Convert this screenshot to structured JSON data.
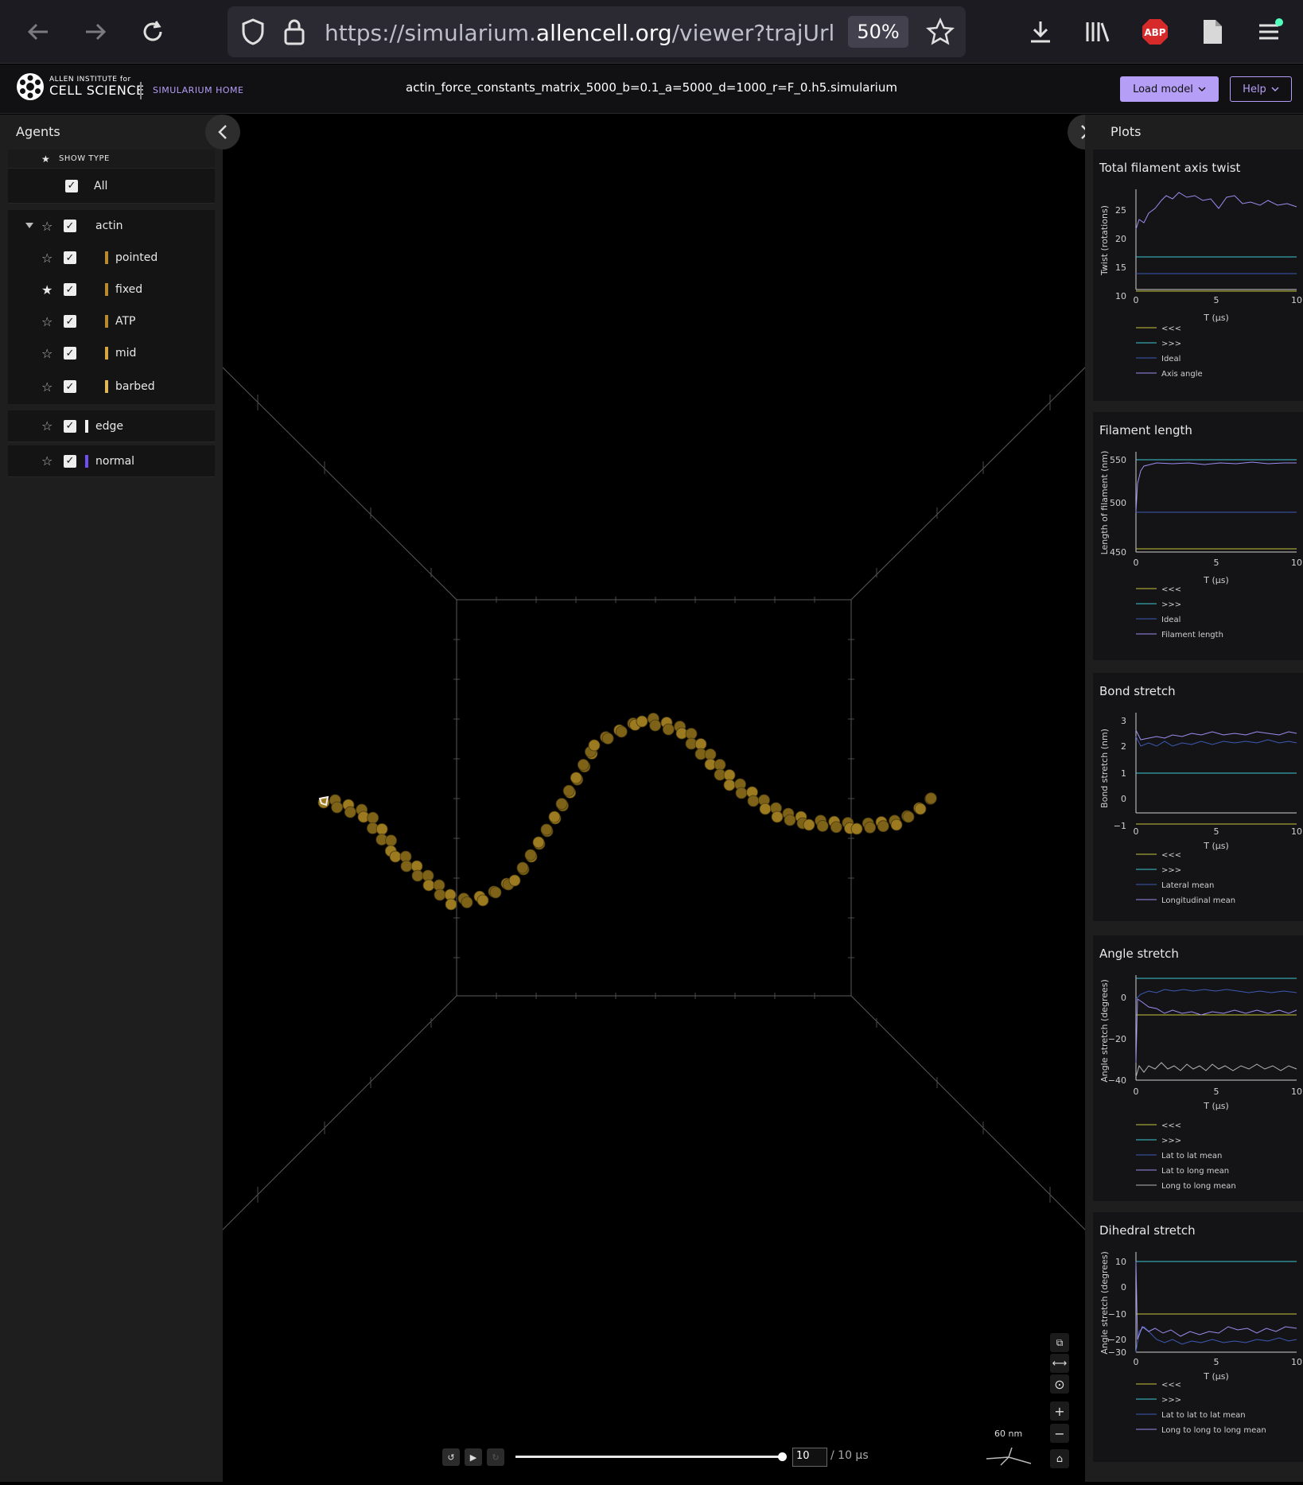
{
  "browser": {
    "url_prefix": "https://simularium.",
    "url_domain": "allencell.org",
    "url_suffix": "/viewer?trajUrl=http",
    "zoom": "50%",
    "abp_label": "ABP"
  },
  "header": {
    "logo_small": "ALLEN INSTITUTE for",
    "logo_big": "CELL SCIENCE",
    "home_link": "SIMULARIUM HOME",
    "file_title": "actin_force_constants_matrix_5000_b=0.1_a=5000_d=1000_r=F_0.h5.simularium",
    "load_model": "Load model",
    "help": "Help"
  },
  "agents_panel": {
    "title": "Agents",
    "show_type": "SHOW TYPE",
    "all_label": "All",
    "groups": [
      {
        "name": "actin",
        "color": "",
        "children": [
          {
            "name": "pointed",
            "color": "#b88a2e",
            "starred": false
          },
          {
            "name": "fixed",
            "color": "#b88a2e",
            "starred": true
          },
          {
            "name": "ATP",
            "color": "#b88a2e",
            "starred": false
          },
          {
            "name": "mid",
            "color": "#d7a640",
            "starred": false
          },
          {
            "name": "barbed",
            "color": "#e0b85a",
            "starred": false
          }
        ]
      },
      {
        "name": "edge",
        "color": "#f0f0f0",
        "children": []
      },
      {
        "name": "normal",
        "color": "#6f4ff0",
        "children": []
      }
    ]
  },
  "plots_panel": {
    "title": "Plots",
    "plots": [
      {
        "title": "Total filament axis twist",
        "ylabel": "Twist (rotations)",
        "xlabel": "T (µs)",
        "yticks": [
          "25",
          "20",
          "15",
          "10"
        ],
        "xticks": [
          "0",
          "5",
          "10"
        ],
        "legend": [
          "<<<",
          ">>>",
          "Ideal",
          "Axis angle"
        ]
      },
      {
        "title": "Filament length",
        "ylabel": "Length of filament (nm)",
        "xlabel": "T (µs)",
        "yticks": [
          "550",
          "500",
          "450"
        ],
        "xticks": [
          "0",
          "5",
          "10"
        ],
        "legend": [
          "<<<",
          ">>>",
          "Ideal",
          "Filament length"
        ]
      },
      {
        "title": "Bond stretch",
        "ylabel": "Bond stretch (nm)",
        "xlabel": "T (µs)",
        "yticks": [
          "3",
          "2",
          "1",
          "0",
          "−1"
        ],
        "xticks": [
          "0",
          "5",
          "10"
        ],
        "legend": [
          "<<<",
          ">>>",
          "Lateral mean",
          "Longitudinal mean"
        ]
      },
      {
        "title": "Angle stretch",
        "ylabel": "Angle stretch (degrees)",
        "xlabel": "T (µs)",
        "yticks": [
          "0",
          "−20",
          "−40"
        ],
        "xticks": [
          "0",
          "5",
          "10"
        ],
        "legend": [
          "<<<",
          ">>>",
          "Lat to lat mean",
          "Lat to long mean",
          "Long to long mean"
        ]
      },
      {
        "title": "Dihedral stretch",
        "ylabel": "Angle stretch (degrees)",
        "xlabel": "T (µs)",
        "yticks": [
          "10",
          "0",
          "−10",
          "−20",
          "−30"
        ],
        "xticks": [
          "0",
          "5",
          "10"
        ],
        "legend": [
          "<<<",
          ">>>",
          "Lat to lat to lat mean",
          "Long to long to long mean"
        ]
      }
    ],
    "legend_colors": [
      "#c8c43c",
      "#3cc8d2",
      "#3c5ab4",
      "#9c8cf0",
      "#b4b4b4"
    ]
  },
  "playback": {
    "time_value": "10",
    "time_total": "/ 10 µs",
    "scale_label": "60 nm"
  },
  "colors": {
    "accent": "#b59ff6",
    "filament": "#8a6a1c"
  }
}
